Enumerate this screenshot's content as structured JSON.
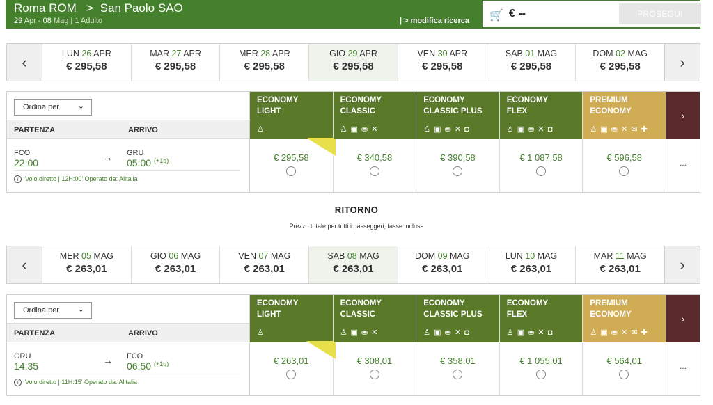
{
  "header": {
    "route_from": "Roma ROM",
    "route_arrow": ">",
    "route_to": "San Paolo SAO",
    "date_out": "29",
    "month_out": "Apr",
    "sep": "-",
    "date_back": "08",
    "month_back": "Mag",
    "pax": "| 1 Adulto",
    "modify_label": "| > modifica ricerca",
    "cart_total": "€ --",
    "proceed_label": "PROSEGUI"
  },
  "outbound_dates": [
    {
      "dow": "LUN",
      "num": "26",
      "mon": "APR",
      "price": "€ 295,58"
    },
    {
      "dow": "MAR",
      "num": "27",
      "mon": "APR",
      "price": "€ 295,58"
    },
    {
      "dow": "MER",
      "num": "28",
      "mon": "APR",
      "price": "€ 295,58"
    },
    {
      "dow": "GIO",
      "num": "29",
      "mon": "APR",
      "price": "€ 295,58"
    },
    {
      "dow": "VEN",
      "num": "30",
      "mon": "APR",
      "price": "€ 295,58"
    },
    {
      "dow": "SAB",
      "num": "01",
      "mon": "MAG",
      "price": "€ 295,58"
    },
    {
      "dow": "DOM",
      "num": "02",
      "mon": "MAG",
      "price": "€ 295,58"
    }
  ],
  "return_dates": [
    {
      "dow": "MER",
      "num": "05",
      "mon": "MAG",
      "price": "€ 263,01"
    },
    {
      "dow": "GIO",
      "num": "06",
      "mon": "MAG",
      "price": "€ 263,01"
    },
    {
      "dow": "VEN",
      "num": "07",
      "mon": "MAG",
      "price": "€ 263,01"
    },
    {
      "dow": "SAB",
      "num": "08",
      "mon": "MAG",
      "price": "€ 263,01"
    },
    {
      "dow": "DOM",
      "num": "09",
      "mon": "MAG",
      "price": "€ 263,01"
    },
    {
      "dow": "LUN",
      "num": "10",
      "mon": "MAG",
      "price": "€ 263,01"
    },
    {
      "dow": "MAR",
      "num": "11",
      "mon": "MAG",
      "price": "€ 263,01"
    }
  ],
  "sort_label": "Ordina per",
  "col_departure": "PARTENZA",
  "col_arrival": "ARRIVO",
  "fare_names": [
    [
      "ECONOMY",
      "LIGHT"
    ],
    [
      "ECONOMY",
      "CLASSIC"
    ],
    [
      "ECONOMY",
      "CLASSIC PLUS"
    ],
    [
      "ECONOMY",
      "FLEX"
    ],
    [
      "PREMIUM",
      "ECONOMY"
    ]
  ],
  "fare_icons": [
    "♙",
    "♙ ▣ ⛂ ✕",
    "♙ ▣ ⛂ ✕ ◘",
    "♙ ▣ ⛂ ✕ ◘",
    "♙ ▣ ⛂ ✕ ✉ ✚"
  ],
  "more_label": "...",
  "outbound_flight": {
    "dep_code": "FCO",
    "dep_time": "22:00",
    "arr_code": "GRU",
    "arr_time": "05:00",
    "plus_day": "(+1g)",
    "info": "Volo diretto | 12H:00' Operato da: Alitalia",
    "fares": [
      "€ 295,58",
      "€ 340,58",
      "€ 390,58",
      "€ 1 087,58",
      "€ 596,58"
    ]
  },
  "return_title": "RITORNO",
  "return_subtitle": "Prezzo totale per tutti i passeggeri, tasse incluse",
  "return_flight": {
    "dep_code": "GRU",
    "dep_time": "14:35",
    "arr_code": "FCO",
    "arr_time": "06:50",
    "plus_day": "(+1g)",
    "info": "Volo diretto | 11H:15' Operato da: Alitalia",
    "fares": [
      "€ 263,01",
      "€ 308,01",
      "€ 358,01",
      "€ 1 055,01",
      "€ 564,01"
    ]
  },
  "colors": {
    "brand_green": "#45812d",
    "fare_green": "#5a7a2a",
    "premium_gold": "#d0ad55",
    "next_maroon": "#5a2a2a",
    "ribbon_yellow": "#e8e04a"
  }
}
